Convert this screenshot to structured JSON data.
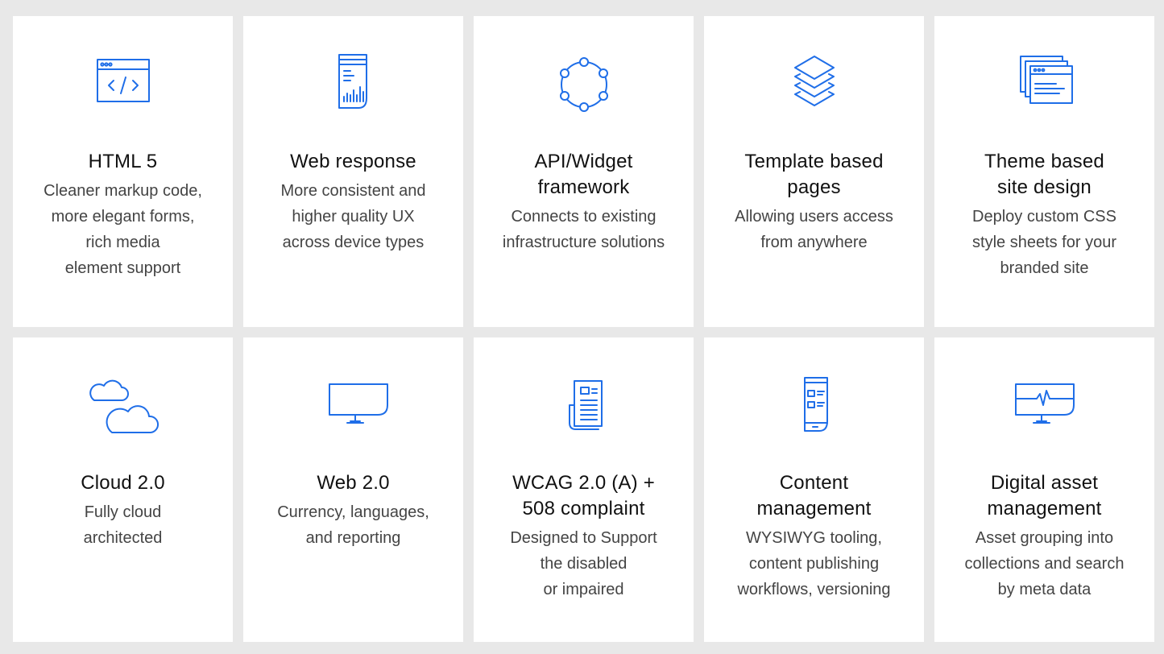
{
  "accent_color": "#1f6ee8",
  "cards": [
    {
      "icon": "code-window-icon",
      "title": "HTML 5",
      "description": "Cleaner markup code,\nmore elegant forms,\nrich media\nelement support"
    },
    {
      "icon": "mobile-analytics-icon",
      "title": "Web response",
      "description": "More consistent and\nhigher quality UX\nacross device types"
    },
    {
      "icon": "network-nodes-icon",
      "title": "API/Widget\nframework",
      "description": "Connects to existing\ninfrastructure solutions"
    },
    {
      "icon": "layers-icon",
      "title": "Template based\npages",
      "description": "Allowing users access\nfrom anywhere"
    },
    {
      "icon": "stacked-windows-icon",
      "title": "Theme based\nsite design",
      "description": "Deploy custom CSS\nstyle sheets for your\nbranded site"
    },
    {
      "icon": "cloud-icon",
      "title": "Cloud 2.0",
      "description": "Fully cloud\narchitected"
    },
    {
      "icon": "monitor-icon",
      "title": "Web 2.0",
      "description": "Currency, languages,\nand reporting"
    },
    {
      "icon": "document-icon",
      "title": "WCAG 2.0 (A) +\n508 complaint",
      "description": "Designed to Support\nthe disabled\nor impaired"
    },
    {
      "icon": "mobile-content-icon",
      "title": "Content\nmanagement",
      "description": "WYSIWYG tooling,\ncontent publishing\nworkflows, versioning"
    },
    {
      "icon": "monitor-pulse-icon",
      "title": "Digital asset\nmanagement",
      "description": "Asset grouping into\ncollections and search\nby meta data"
    }
  ]
}
